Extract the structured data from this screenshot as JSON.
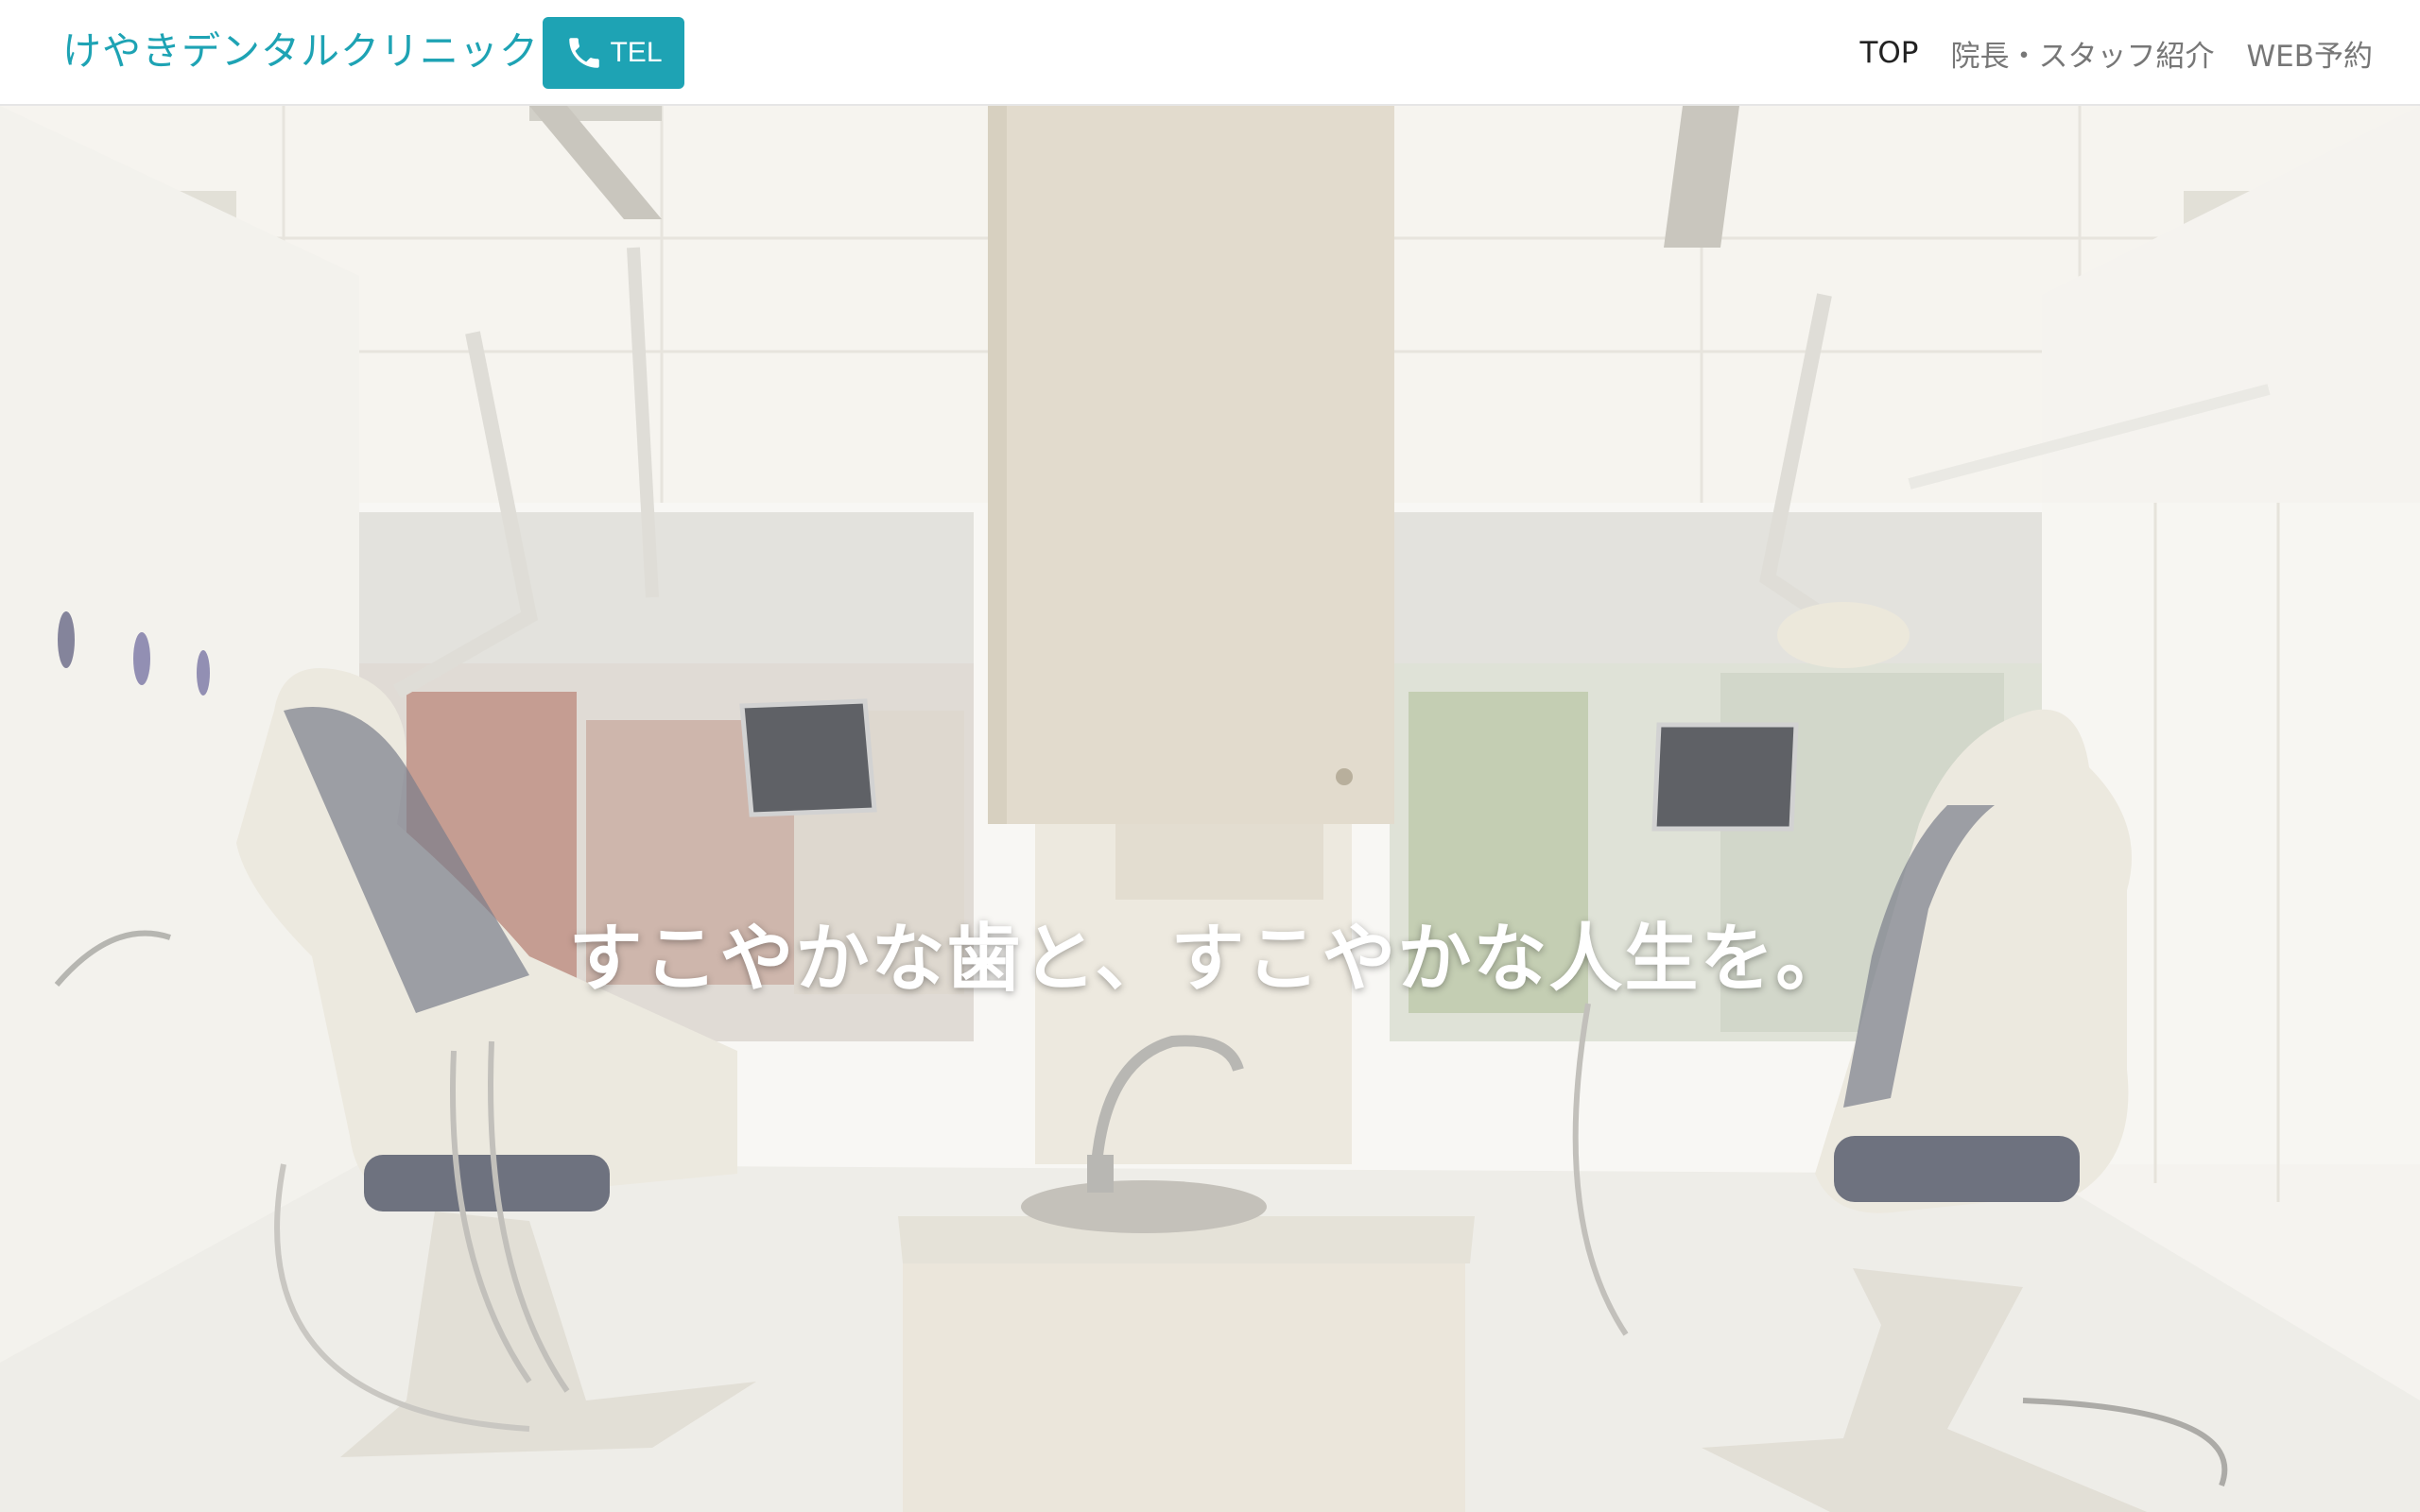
{
  "header": {
    "logo": "けやきデンタルクリニック",
    "tel_button": {
      "icon": "phone-icon",
      "label": "TEL"
    },
    "nav": [
      {
        "label": "TOP",
        "active": true
      },
      {
        "label": "院長・スタッフ紹介",
        "active": false
      },
      {
        "label": "WEB予約",
        "active": false
      }
    ]
  },
  "hero": {
    "tagline": "すこやかな歯と、すこやかな人生を。",
    "background_image": "dental-clinic-treatment-room-photo"
  },
  "colors": {
    "accent": "#1ea3b4",
    "nav_active": "#222222",
    "nav_inactive": "#777777"
  }
}
